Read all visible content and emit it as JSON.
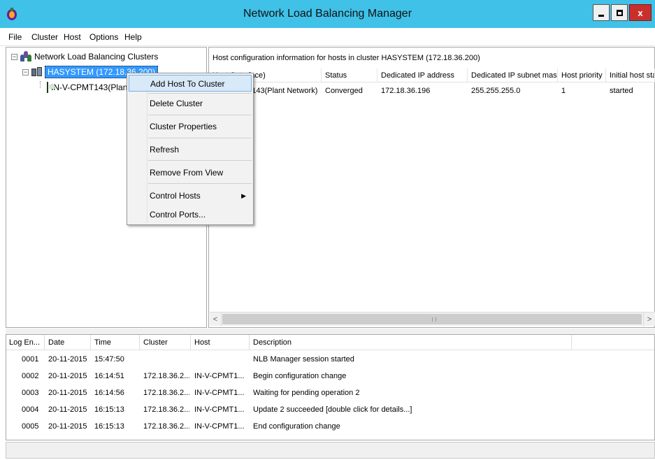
{
  "window": {
    "title": "Network Load Balancing Manager",
    "buttons": {
      "minimize": "minimize",
      "maximize": "maximize",
      "close": "x"
    },
    "titlebar_color": "#3fc1e8",
    "close_color": "#c9302c"
  },
  "menu": [
    "File",
    "Cluster",
    "Host",
    "Options",
    "Help"
  ],
  "tree": {
    "root": {
      "label": "Network Load Balancing Clusters",
      "icon": "clusters-icon"
    },
    "cluster": {
      "label": "HASYSTEM (172.18.36.200)",
      "icon": "cluster-icon",
      "selected": true
    },
    "host": {
      "label": "IN-V-CPMT143(Plant Network)",
      "icon": "host-icon"
    }
  },
  "host_panel": {
    "info": "Host configuration information for hosts in cluster HASYSTEM (172.18.36.200)",
    "columns": [
      "Host (Interface)",
      "Status",
      "Dedicated IP address",
      "Dedicated IP subnet mask",
      "Host priority",
      "Initial host state"
    ],
    "rows": [
      [
        "IN-V-CPMT143(Plant Network)",
        "Converged",
        "172.18.36.196",
        "255.255.255.0",
        "1",
        "started"
      ]
    ]
  },
  "context_menu": {
    "items": [
      {
        "label": "Add Host To Cluster",
        "highlighted": true
      },
      {
        "label": "Delete Cluster"
      },
      {
        "label": "Cluster Properties"
      },
      {
        "label": "Refresh"
      },
      {
        "label": "Remove From View"
      },
      {
        "label": "Control Hosts",
        "submenu": true
      },
      {
        "label": "Control Ports..."
      }
    ],
    "submenu_arrow": "▶"
  },
  "scrollbar": {
    "left_arrow": "<",
    "right_arrow": ">"
  },
  "log": {
    "columns": [
      "Log En...",
      "Date",
      "Time",
      "Cluster",
      "Host",
      "Description"
    ],
    "rows": [
      [
        "0001",
        "20-11-2015",
        "15:47:50",
        "",
        "",
        "NLB Manager session started"
      ],
      [
        "0002",
        "20-11-2015",
        "16:14:51",
        "172.18.36.2...",
        "IN-V-CPMT1...",
        "Begin configuration change"
      ],
      [
        "0003",
        "20-11-2015",
        "16:14:56",
        "172.18.36.2...",
        "IN-V-CPMT1...",
        "Waiting for pending operation 2"
      ],
      [
        "0004",
        "20-11-2015",
        "16:15:13",
        "172.18.36.2...",
        "IN-V-CPMT1...",
        "Update 2 succeeded [double click for details...]"
      ],
      [
        "0005",
        "20-11-2015",
        "16:15:13",
        "172.18.36.2...",
        "IN-V-CPMT1...",
        "End configuration change"
      ]
    ]
  }
}
